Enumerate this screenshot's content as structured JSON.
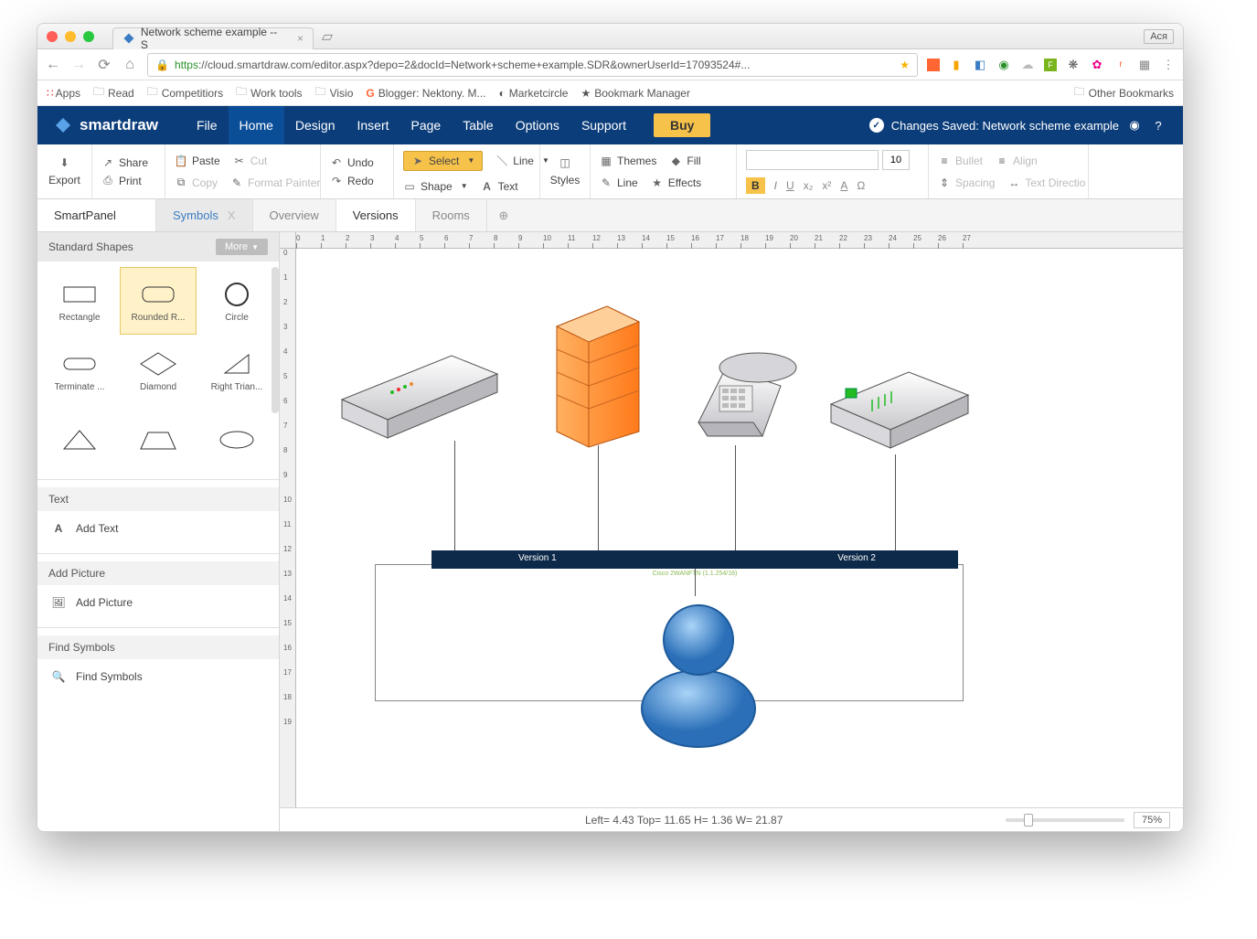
{
  "browser": {
    "tab_title": "Network scheme example -- S",
    "user_label": "Ася",
    "url_https": "https",
    "url_host": "://cloud.smartdraw.com",
    "url_path": "/editor.aspx?depo=2&docId=Network+scheme+example.SDR&ownerUserId=17093524#...",
    "bookmarks": [
      "Apps",
      "Read",
      "Competitiors",
      "Work tools",
      "Visio",
      "Blogger: Nektony. M...",
      "Marketcircle",
      "Bookmark Manager"
    ],
    "other_bookmarks": "Other Bookmarks"
  },
  "app": {
    "logo": "smartdraw",
    "menu": [
      "File",
      "Home",
      "Design",
      "Insert",
      "Page",
      "Table",
      "Options",
      "Support"
    ],
    "buy": "Buy",
    "status_prefix": "Changes Saved: ",
    "status_doc": "Network scheme example"
  },
  "ribbon": {
    "export": "Export",
    "share": "Share",
    "print": "Print",
    "paste": "Paste",
    "cut": "Cut",
    "copy": "Copy",
    "format_painter": "Format Painter",
    "undo": "Undo",
    "redo": "Redo",
    "select": "Select",
    "line": "Line",
    "shape": "Shape",
    "text": "Text",
    "styles": "Styles",
    "themes": "Themes",
    "fill": "Fill",
    "rline": "Line",
    "effects": "Effects",
    "font_size": "10",
    "bullet": "Bullet",
    "spacing": "Spacing",
    "align": "Align",
    "text_dir": "Text Directio"
  },
  "tabs": {
    "smartpanel": "SmartPanel",
    "symbols": "Symbols",
    "overview": "Overview",
    "versions": "Versions",
    "rooms": "Rooms"
  },
  "side": {
    "shapes_title": "Standard Shapes",
    "more": "More",
    "shapes": [
      "Rectangle",
      "Rounded R...",
      "Circle",
      "Terminate ...",
      "Diamond",
      "Right Trian..."
    ],
    "text_title": "Text",
    "add_text": "Add Text",
    "pic_title": "Add Picture",
    "add_picture": "Add Picture",
    "find_title": "Find Symbols",
    "find_symbols": "Find Symbols"
  },
  "diagram": {
    "v1": "Version 1",
    "v2": "Version 2",
    "switch_sub": "Cisco 2WANFTN (1.1.254/16)"
  },
  "status": {
    "coords": "Left= 4.43 Top= 11.65 H= 1.36 W= 21.87",
    "zoom": "75%"
  }
}
